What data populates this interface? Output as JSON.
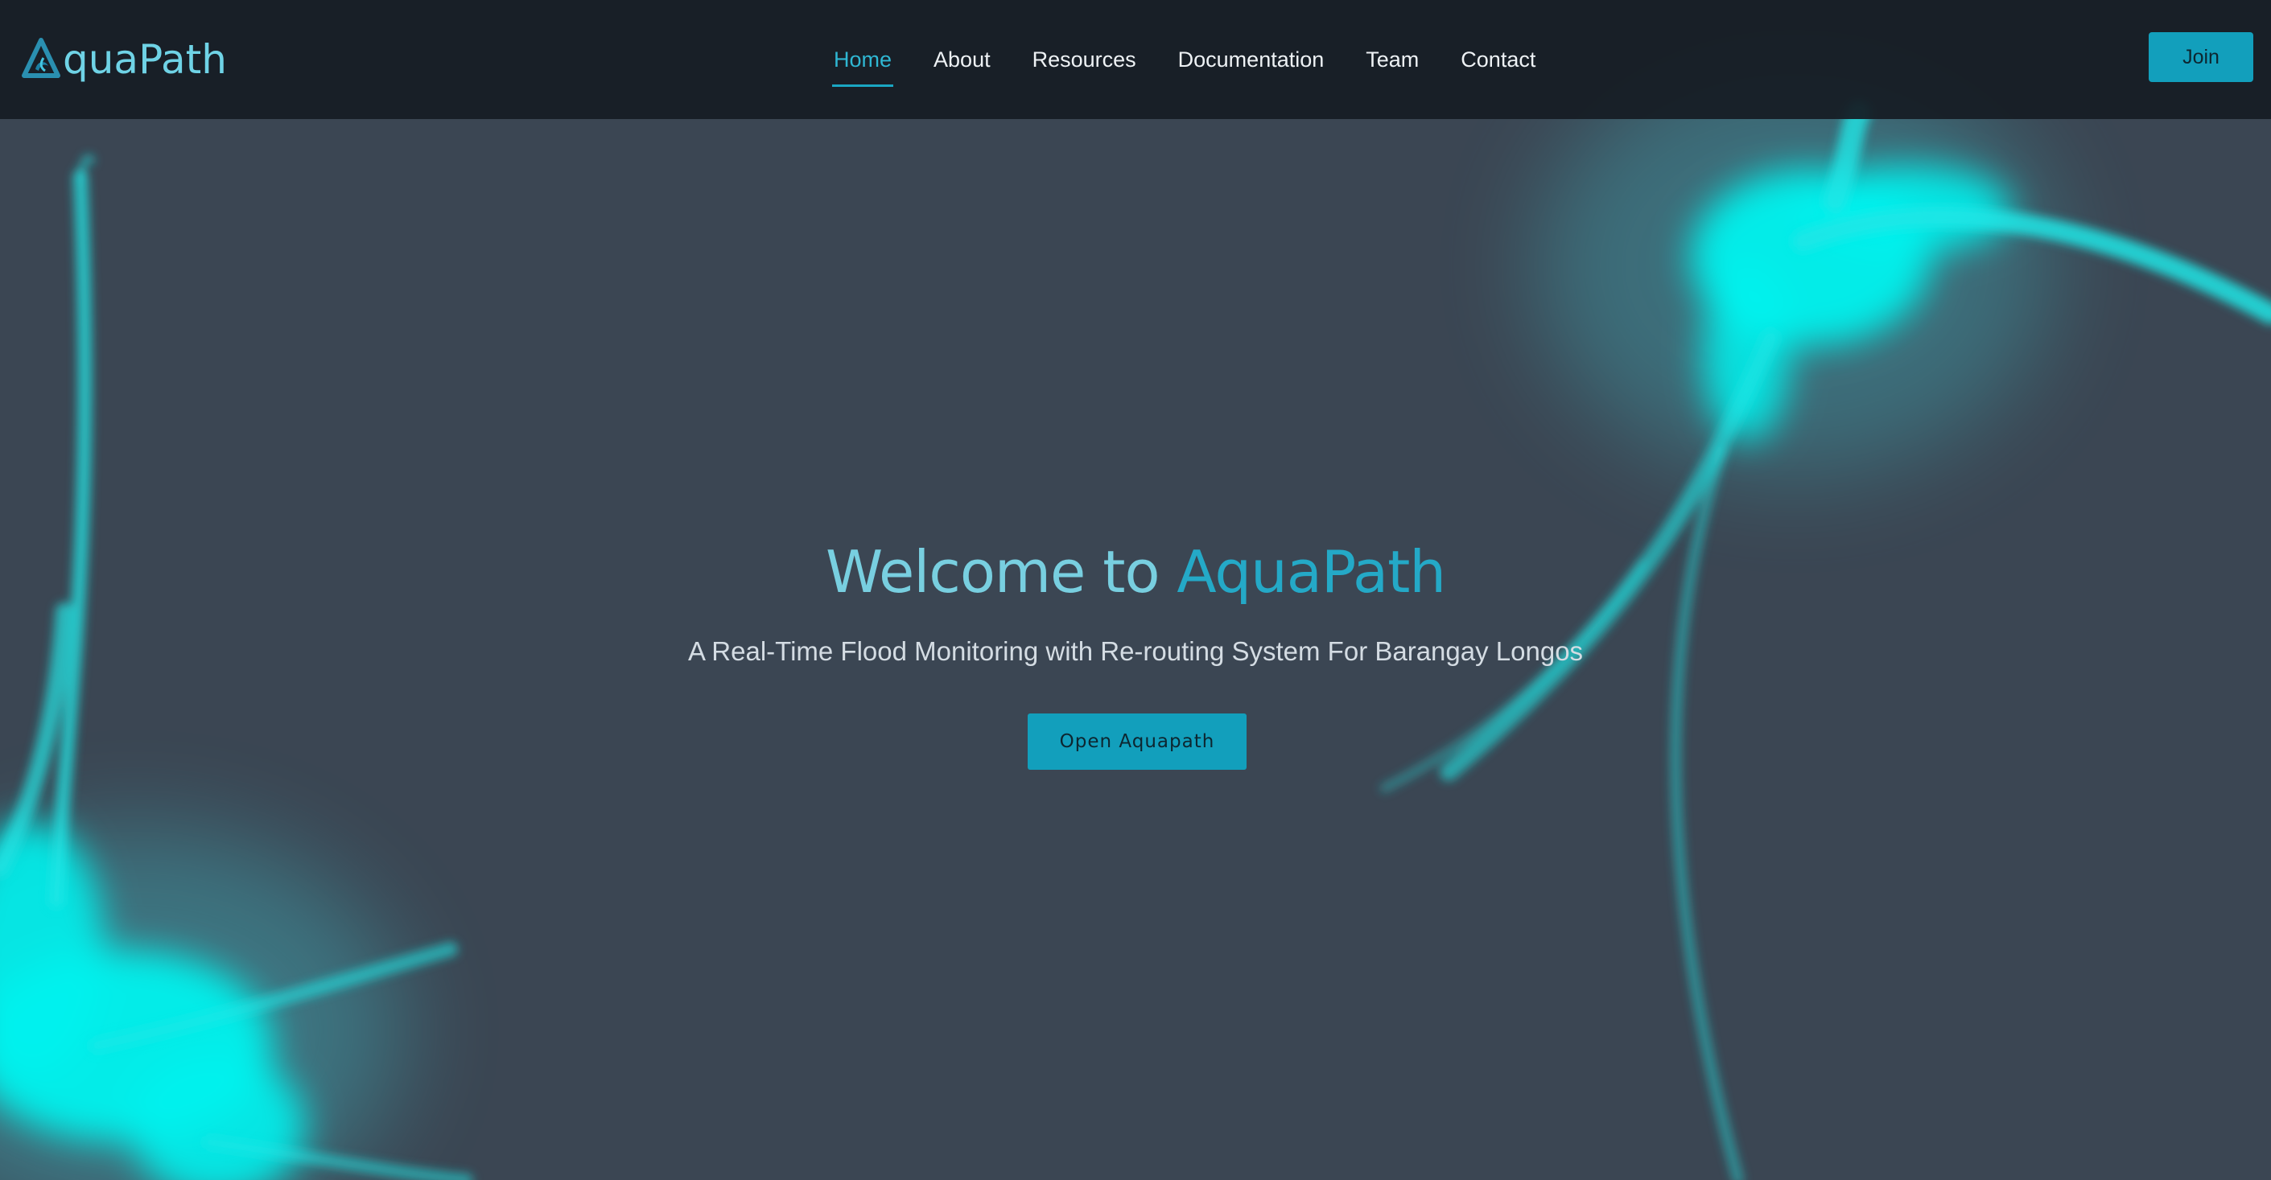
{
  "brand": {
    "logo_icon": "aquapath-logo-icon",
    "name_suffix": "quaPath",
    "color": "#6fd3e6"
  },
  "nav": {
    "items": [
      {
        "label": "Home",
        "active": true
      },
      {
        "label": "About",
        "active": false
      },
      {
        "label": "Resources",
        "active": false
      },
      {
        "label": "Documentation",
        "active": false
      },
      {
        "label": "Team",
        "active": false
      },
      {
        "label": "Contact",
        "active": false
      }
    ],
    "join_label": "Join"
  },
  "hero": {
    "title_prefix": "Welcome to",
    "title_accent": "AquaPath",
    "subtitle": "A Real-Time Flood Monitoring with Re-routing System For Barangay Longos",
    "cta_label": "Open Aquapath"
  },
  "colors": {
    "accent": "#129fbc",
    "glow": "#00f0ee",
    "background": "#3b4653",
    "header": "#161c24"
  }
}
